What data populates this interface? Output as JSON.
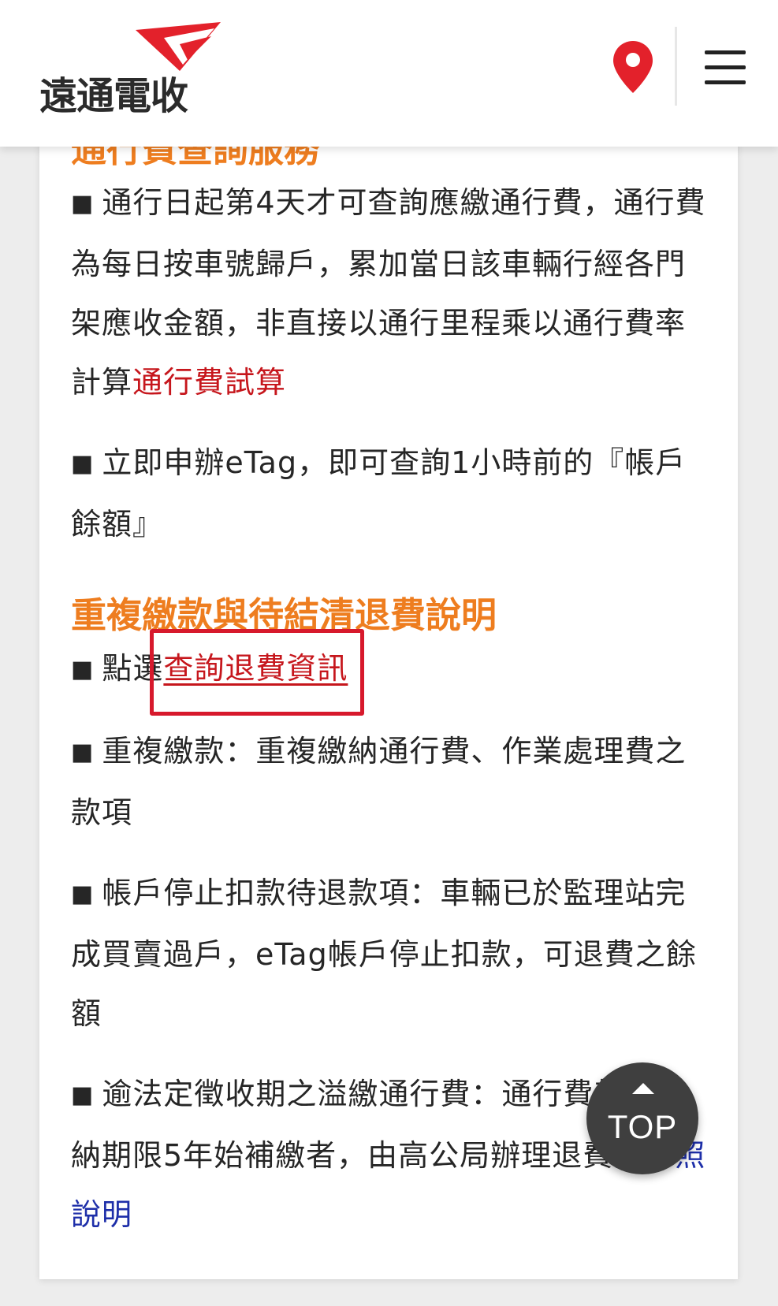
{
  "header": {
    "logo_text": "遠通電收",
    "location_icon": "map-pin-icon",
    "menu_icon": "hamburger-menu-icon"
  },
  "section1": {
    "heading": "通行費查詢服務",
    "p1_text": "通行日起第4天才可查詢應繳通行費，通行費為每日按車號歸戶，累加當日該車輛行經各門架應收金額，非直接以通行里程乘以通行費率計算",
    "p1_link": "通行費試算",
    "p2_text": "立即申辦eTag，即可查詢1小時前的『帳戶餘額』"
  },
  "section2": {
    "heading": "重複繳款與待結清退費說明",
    "p1_prefix": "點選",
    "p1_link": "查詢退費資訊",
    "p2_text": "重複繳款：重複繳納通行費、作業處理費之款項",
    "p3_text": "帳戶停止扣款待退款項：車輛已於監理站完成買賣過戶，eTag帳戶停止扣款，可退費之餘額",
    "p4_text": "逾法定徵收期之溢繳通行費：通行費超過繳納期限5年始補繳者，由高公局辦理退費",
    "p4_link": "請參照說明"
  },
  "bullet_symbol": "■",
  "top_button": {
    "label": "TOP",
    "icon": "up-triangle-icon"
  },
  "colors": {
    "accent_orange": "#ee7d1f",
    "link_red": "#c6161c",
    "link_blue": "#1e2fa9",
    "highlight_box": "#d7192c",
    "brand_red": "#e3212b"
  }
}
